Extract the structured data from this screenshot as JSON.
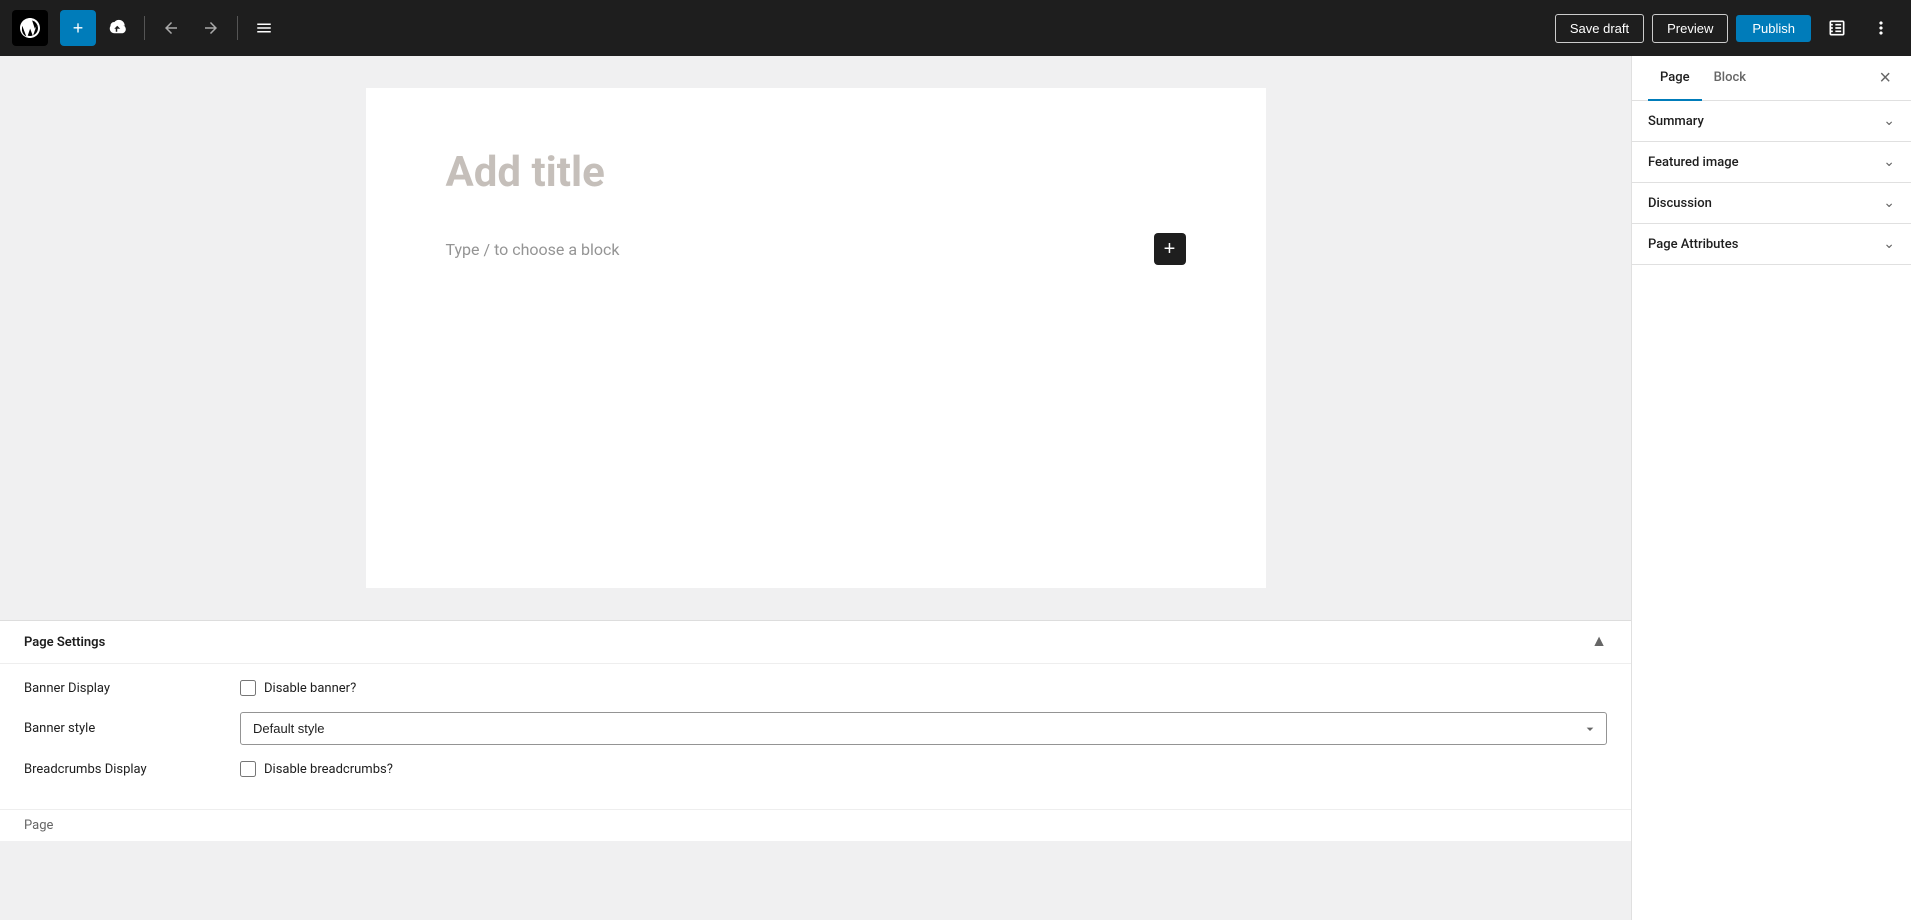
{
  "toolbar": {
    "add_label": "+",
    "save_draft_label": "Save draft",
    "preview_label": "Preview",
    "publish_label": "Publish"
  },
  "editor": {
    "title_placeholder": "Add title",
    "block_placeholder": "Type / to choose a block"
  },
  "sidebar": {
    "tab_page_label": "Page",
    "tab_block_label": "Block",
    "close_label": "×",
    "sections": [
      {
        "id": "summary",
        "title": "Summary"
      },
      {
        "id": "featured-image",
        "title": "Featured image"
      },
      {
        "id": "discussion",
        "title": "Discussion"
      },
      {
        "id": "page-attributes",
        "title": "Page Attributes"
      }
    ]
  },
  "page_settings": {
    "title": "Page Settings",
    "banner_display_label": "Banner Display",
    "banner_display_checkbox_label": "Disable banner?",
    "banner_style_label": "Banner style",
    "banner_style_default": "Default style",
    "banner_style_options": [
      "Default style"
    ],
    "breadcrumbs_display_label": "Breadcrumbs Display",
    "breadcrumbs_checkbox_label": "Disable breadcrumbs?",
    "footer_label": "Page"
  }
}
